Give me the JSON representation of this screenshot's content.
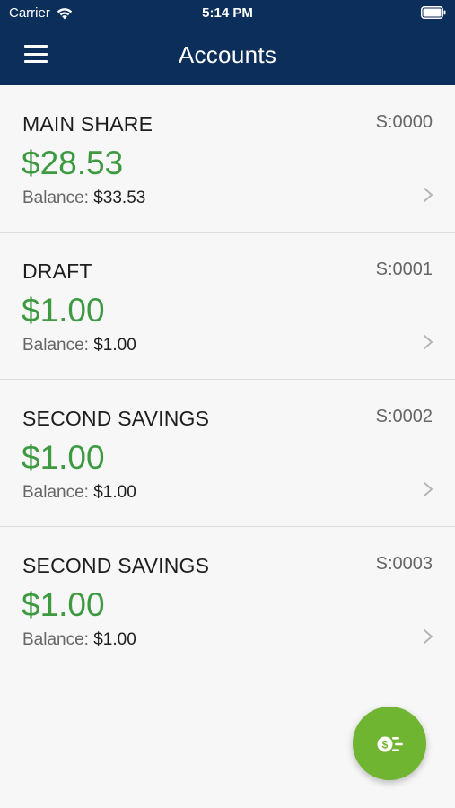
{
  "status_bar": {
    "carrier": "Carrier",
    "time": "5:14 PM"
  },
  "nav": {
    "title": "Accounts",
    "menu_icon": "hamburger-menu-icon"
  },
  "balance_label": "Balance:",
  "accounts": [
    {
      "name": "MAIN SHARE",
      "id": "S:0000",
      "available": "$28.53",
      "balance": "$33.53"
    },
    {
      "name": "DRAFT",
      "id": "S:0001",
      "available": "$1.00",
      "balance": "$1.00"
    },
    {
      "name": "SECOND SAVINGS",
      "id": "S:0002",
      "available": "$1.00",
      "balance": "$1.00"
    },
    {
      "name": "SECOND SAVINGS",
      "id": "S:0003",
      "available": "$1.00",
      "balance": "$1.00"
    }
  ],
  "fab": {
    "icon": "transfer-money-icon"
  },
  "colors": {
    "header_bg": "#0b2e5a",
    "amount_green": "#3d9a41",
    "fab_green": "#70b531",
    "background": "#f7f7f7"
  }
}
